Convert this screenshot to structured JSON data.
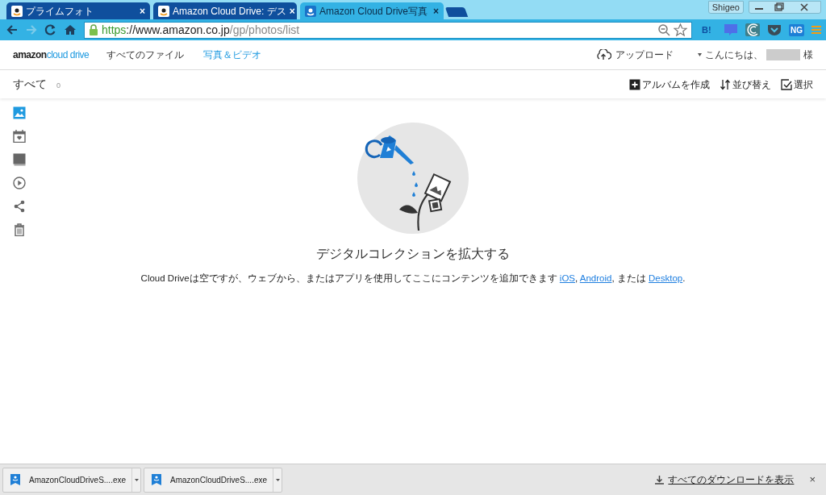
{
  "browser": {
    "tabs": [
      {
        "title": "プライムフォト",
        "selected": false
      },
      {
        "title": "Amazon Cloud Drive: デス",
        "selected": false
      },
      {
        "title": "Amazon Cloud Drive写真",
        "selected": true
      }
    ],
    "tab_close": "×",
    "profile": "Shigeo",
    "url": {
      "scheme": "https",
      "host": "://www.amazon.co.jp",
      "path": "/gp/photos/list"
    },
    "extensions": [
      {
        "kind": "hatena",
        "label": "B!"
      },
      {
        "kind": "chat"
      },
      {
        "kind": "feedly"
      },
      {
        "kind": "pocket"
      },
      {
        "kind": "ng",
        "label": "NG"
      }
    ]
  },
  "app": {
    "logo": {
      "brand": "amazon",
      "product": "cloud drive"
    },
    "nav": [
      {
        "label": "すべてのファイル",
        "selected": false
      },
      {
        "label": "写真＆ビデオ",
        "selected": true
      }
    ],
    "upload": "アップロード",
    "greeting": "こんにちは、",
    "honorific": "様",
    "toolbar": {
      "title": "すべて",
      "count": "0",
      "actions": [
        {
          "kind": "album",
          "label": "アルバムを作成"
        },
        {
          "kind": "sort",
          "label": "並び替え"
        },
        {
          "kind": "select",
          "label": "選択"
        }
      ]
    },
    "sidebar": [
      {
        "kind": "photos",
        "selected": true
      },
      {
        "kind": "calendar",
        "selected": false
      },
      {
        "kind": "album",
        "selected": false
      },
      {
        "kind": "video",
        "selected": false
      },
      {
        "kind": "share",
        "selected": false
      },
      {
        "kind": "trash",
        "selected": false
      }
    ],
    "empty": {
      "heading": "デジタルコレクションを拡大する",
      "parts": [
        {
          "text": "Cloud Driveは空ですが、ウェブから、またはアプリを使用してここにコンテンツを追加できます ",
          "link": false
        },
        {
          "text": "iOS",
          "link": true
        },
        {
          "text": ", ",
          "link": false
        },
        {
          "text": "Android",
          "link": true
        },
        {
          "text": ", または ",
          "link": false
        },
        {
          "text": "Desktop",
          "link": true
        },
        {
          "text": ".",
          "link": false
        }
      ]
    }
  },
  "downloads": {
    "items": [
      {
        "file": "AmazonCloudDriveS....exe"
      },
      {
        "file": "AmazonCloudDriveS....exe"
      }
    ],
    "show_all": "すべてのダウンロードを表示",
    "close": "×"
  }
}
